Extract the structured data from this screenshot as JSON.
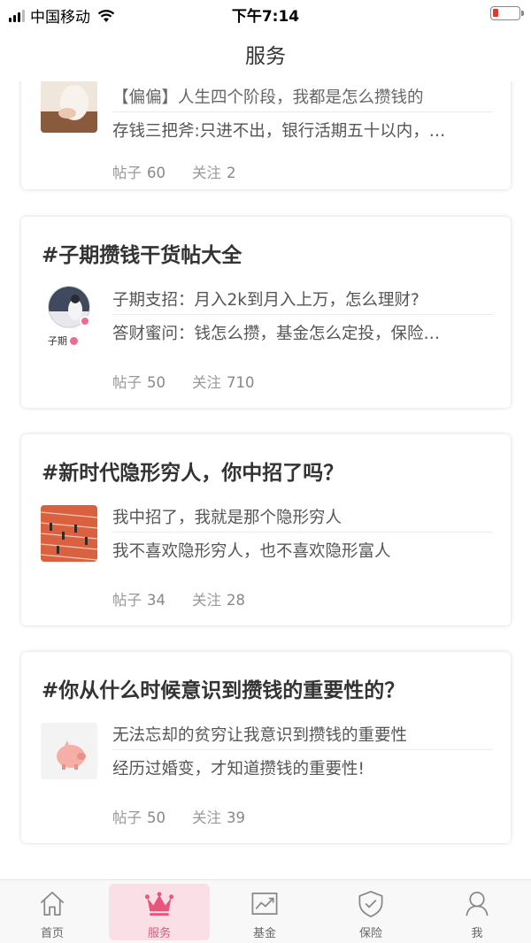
{
  "status_bar": {
    "carrier": "中国移动",
    "time": "下午7:14"
  },
  "nav": {
    "title": "服务"
  },
  "cards": [
    {
      "title": "",
      "line1": "【偏偏】人生四个阶段，我都是怎么攒钱的",
      "line2": "存钱三把斧:只进不出，银行活期五十以内，…",
      "posts_label": "帖子",
      "posts": "60",
      "follow_label": "关注",
      "follow": "2"
    },
    {
      "title": "#子期攒钱干货帖大全",
      "author": "子期",
      "line1": "子期支招：月入2k到月入上万，怎么理财?",
      "line2": "答财蜜问：钱怎么攒，基金怎么定投，保险…",
      "posts_label": "帖子",
      "posts": "50",
      "follow_label": "关注",
      "follow": "710"
    },
    {
      "title": "#新时代隐形穷人，你中招了吗？",
      "line1": "我中招了，我就是那个隐形穷人",
      "line2": "我不喜欢隐形穷人，也不喜欢隐形富人",
      "posts_label": "帖子",
      "posts": "34",
      "follow_label": "关注",
      "follow": "28"
    },
    {
      "title": "#你从什么时候意识到攒钱的重要性的？",
      "line1": "无法忘却的贫穷让我意识到攒钱的重要性",
      "line2": "经历过婚变，才知道攒钱的重要性!",
      "posts_label": "帖子",
      "posts": "50",
      "follow_label": "关注",
      "follow": "39"
    }
  ],
  "tabs": [
    {
      "label": "首页",
      "icon": "home-icon"
    },
    {
      "label": "服务",
      "icon": "crown-icon",
      "active": true
    },
    {
      "label": "基金",
      "icon": "chart-icon"
    },
    {
      "label": "保险",
      "icon": "shield-icon"
    },
    {
      "label": "我",
      "icon": "person-icon"
    }
  ],
  "colors": {
    "accent": "#e8557a",
    "active_tab_bg": "#fbdfe6",
    "battery_low": "#e8352e"
  }
}
